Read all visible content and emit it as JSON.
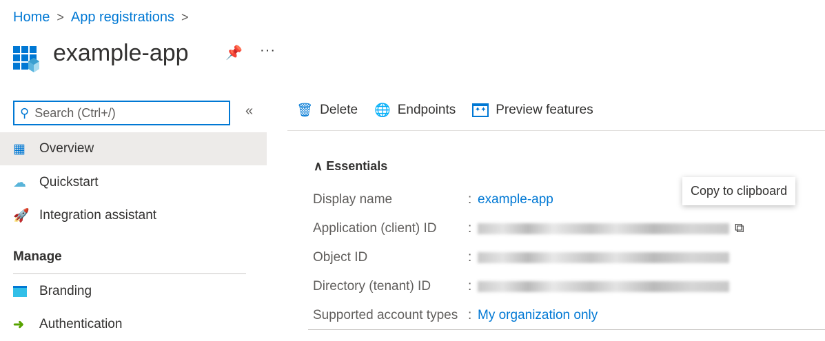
{
  "breadcrumb": [
    "Home",
    "App registrations"
  ],
  "title": "example-app",
  "search": {
    "placeholder": "Search (Ctrl+/)"
  },
  "nav": [
    {
      "label": "Overview",
      "icon": "app-grid-icon"
    },
    {
      "label": "Quickstart",
      "icon": "cloud-lightning-icon"
    },
    {
      "label": "Integration assistant",
      "icon": "rocket-icon"
    }
  ],
  "manage": {
    "heading": "Manage",
    "items": [
      {
        "label": "Branding",
        "icon": "www-icon"
      },
      {
        "label": "Authentication",
        "icon": "sign-in-icon"
      }
    ]
  },
  "toolbar": {
    "delete": "Delete",
    "endpoints": "Endpoints",
    "preview": "Preview features"
  },
  "essentials": {
    "heading": "Essentials",
    "rows": [
      {
        "label": "Display name",
        "value": "example-app"
      },
      {
        "label": "Application (client) ID"
      },
      {
        "label": "Object ID"
      },
      {
        "label": "Directory (tenant) ID"
      },
      {
        "label": "Supported account types",
        "value": "My organization only"
      }
    ]
  },
  "tooltip": "Copy to clipboard",
  "colors": {
    "accent": "#0078d4",
    "selected": "#edebe9"
  }
}
